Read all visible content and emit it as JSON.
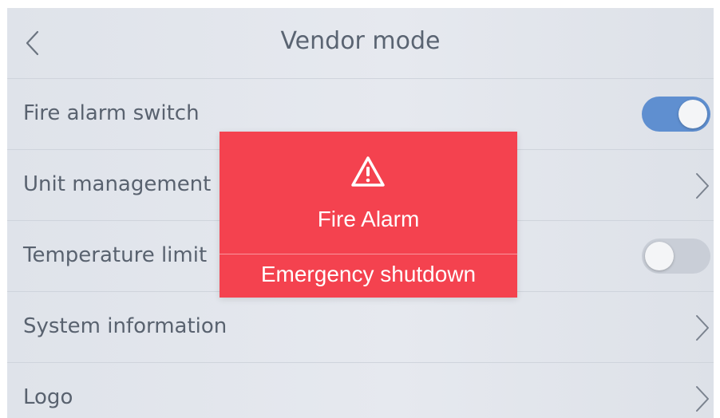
{
  "header": {
    "title": "Vendor mode",
    "back_icon": "chevron-left-icon"
  },
  "settings": {
    "items": [
      {
        "label": "Fire alarm switch",
        "control": "toggle",
        "state": "on"
      },
      {
        "label": "Unit management",
        "control": "chevron"
      },
      {
        "label": "Temperature limit",
        "control": "toggle",
        "state": "off"
      },
      {
        "label": "System information",
        "control": "chevron"
      },
      {
        "label": "Logo",
        "control": "chevron"
      }
    ]
  },
  "alarm": {
    "icon": "warning-triangle-icon",
    "title": "Fire Alarm",
    "action_label": "Emergency shutdown"
  },
  "colors": {
    "alarm_background": "#f4424f",
    "toggle_on": "#5f8fd0",
    "toggle_off": "#c9ced7",
    "text": "#59626f"
  }
}
